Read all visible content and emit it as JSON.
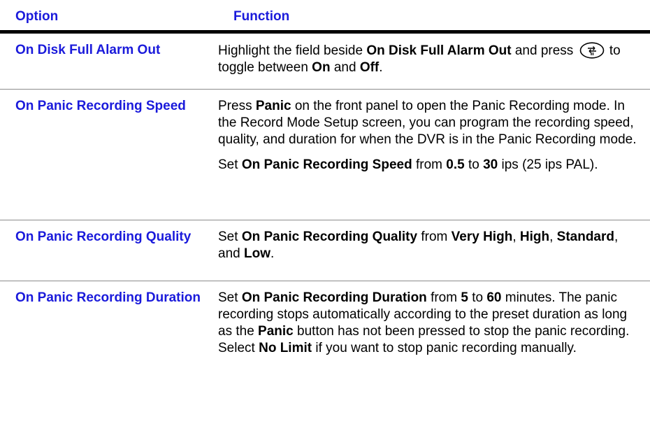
{
  "header": {
    "option": "Option",
    "function": "Function"
  },
  "rows": [
    {
      "option": "On Disk Full Alarm Out",
      "function": [
        [
          {
            "t": "Highlight the field beside ",
            "b": false
          },
          {
            "t": "On Disk Full Alarm Out",
            "b": true
          },
          {
            "t": " and press ",
            "b": false
          },
          {
            "icon": "enter-key-icon"
          },
          {
            "t": " to toggle between ",
            "b": false
          },
          {
            "t": "On",
            "b": true
          },
          {
            "t": " and ",
            "b": false
          },
          {
            "t": "Off",
            "b": true
          },
          {
            "t": ".",
            "b": false
          }
        ]
      ]
    },
    {
      "option": "On Panic Recording Speed",
      "function": [
        [
          {
            "t": "Press ",
            "b": false
          },
          {
            "t": "Panic",
            "b": true
          },
          {
            "t": " on the front panel to open the Panic Recording mode. In the Record Mode Setup screen, you can program the recording speed, quality, and duration for when the DVR is in the Panic Recording mode.",
            "b": false
          }
        ],
        [
          {
            "t": "Set ",
            "b": false
          },
          {
            "t": "On Panic Recording Speed",
            "b": true
          },
          {
            "t": " from ",
            "b": false
          },
          {
            "t": "0.5",
            "b": true
          },
          {
            "t": " to ",
            "b": false
          },
          {
            "t": "30",
            "b": true
          },
          {
            "t": " ips (25 ips PAL).",
            "b": false
          }
        ]
      ]
    },
    {
      "option": "On Panic Recording Quality",
      "function": [
        [
          {
            "t": "Set ",
            "b": false
          },
          {
            "t": "On Panic Recording Quality",
            "b": true
          },
          {
            "t": " from ",
            "b": false
          },
          {
            "t": "Very High",
            "b": true
          },
          {
            "t": ", ",
            "b": false
          },
          {
            "t": "High",
            "b": true
          },
          {
            "t": ", ",
            "b": false
          },
          {
            "t": "Standard",
            "b": true
          },
          {
            "t": ", and ",
            "b": false
          },
          {
            "t": "Low",
            "b": true
          },
          {
            "t": ".",
            "b": false
          }
        ]
      ]
    },
    {
      "option": "On Panic Recording Duration",
      "function": [
        [
          {
            "t": "Set ",
            "b": false
          },
          {
            "t": "On Panic Recording Duration",
            "b": true
          },
          {
            "t": " from ",
            "b": false
          },
          {
            "t": "5",
            "b": true
          },
          {
            "t": " to ",
            "b": false
          },
          {
            "t": "60",
            "b": true
          },
          {
            "t": " minutes. The panic recording stops automatically according to the preset duration as long as the ",
            "b": false
          },
          {
            "t": "Panic",
            "b": true
          },
          {
            "t": " button has not been pressed to stop the panic recording. Select ",
            "b": false
          },
          {
            "t": "No Limit",
            "b": true
          },
          {
            "t": " if you want to stop panic recording manually.",
            "b": false
          }
        ]
      ]
    }
  ],
  "colors": {
    "option_text": "#1a1adb",
    "header_rule": "#000000",
    "row_rule": "#8c8c8c"
  }
}
